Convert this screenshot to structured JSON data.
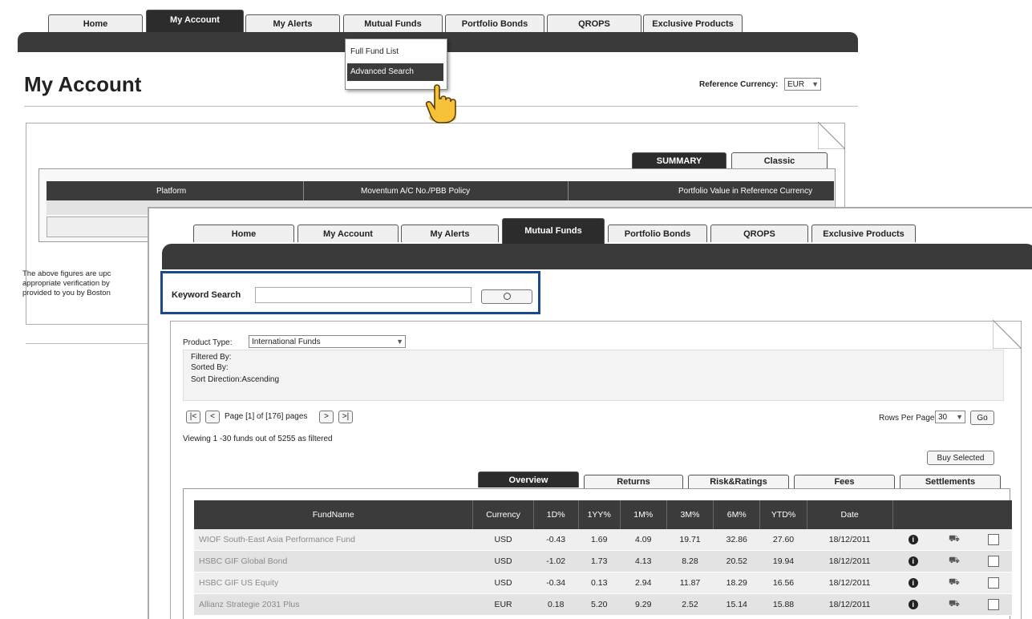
{
  "back": {
    "tabs": [
      "Home",
      "My Account",
      "My Alerts",
      "Mutual Funds",
      "Portfolio Bonds",
      "QROPS",
      "Exclusive Products"
    ],
    "active_tab": "My Account",
    "dropdown": [
      "Full Fund List",
      "Advanced Search"
    ],
    "page_title": "My Account",
    "ref_currency_label": "Reference Currency:",
    "ref_currency_value": "EUR",
    "subtabs": [
      "SUMMARY",
      "Classic"
    ],
    "table_headers": [
      "Platform",
      "Moventum A/C No./PBB Policy",
      "Portfolio Value in Reference Currency"
    ],
    "disclaimer": [
      "The above figures are upc",
      "appropriate verification by",
      "provided to you by Boston"
    ]
  },
  "front": {
    "tabs": [
      "Home",
      "My Account",
      "My Alerts",
      "Mutual Funds",
      "Portfolio Bonds",
      "QROPS",
      "Exclusive Products"
    ],
    "active_tab": "Mutual Funds",
    "keyword_label": "Keyword Search",
    "keyword_placeholder": "",
    "product_type_label": "Product Type:",
    "product_type_value": "International Funds",
    "filtered_by": "Filtered By:",
    "sorted_by": "Sorted By:",
    "sort_direction": "Sort Direction:Ascending",
    "pager_first": "|<",
    "pager_prev": "<",
    "pager_text": "Page [1] of [176] pages",
    "pager_next": ">",
    "pager_last": ">|",
    "rows_per_page_label": "Rows Per Page",
    "rows_per_page_value": "30",
    "go_label": "Go",
    "viewing": "Viewing 1 -30 funds out of 5255 as filtered",
    "buy_selected": "Buy Selected",
    "subtabs": [
      "Overview",
      "Returns",
      "Risk&Ratings",
      "Fees",
      "Settlements"
    ],
    "active_subtab": "Overview",
    "columns": [
      "FundName",
      "Currency",
      "1D%",
      "1YY%",
      "1M%",
      "3M%",
      "6M%",
      "YTD%",
      "Date"
    ],
    "rows": [
      [
        "WIOF South-East Asia Performance Fund",
        "USD",
        "-0.43",
        "1.69",
        "4.09",
        "19.71",
        "32.86",
        "27.60",
        "18/12/2011"
      ],
      [
        "HSBC GIF Global Bond",
        "USD",
        "-1.02",
        "1.73",
        "4.13",
        "8.28",
        "20.52",
        "19.94",
        "18/12/2011"
      ],
      [
        "HSBC GIF US Equity",
        "USD",
        "-0.34",
        "0.13",
        "2.94",
        "11.87",
        "18.29",
        "16.56",
        "18/12/2011"
      ],
      [
        "Allianz Strategie 2031 Plus",
        "EUR",
        "0.18",
        "5.20",
        "9.29",
        "2.52",
        "15.14",
        "15.88",
        "18/12/2011"
      ]
    ],
    "highlight_color": "#1a4a8c"
  }
}
